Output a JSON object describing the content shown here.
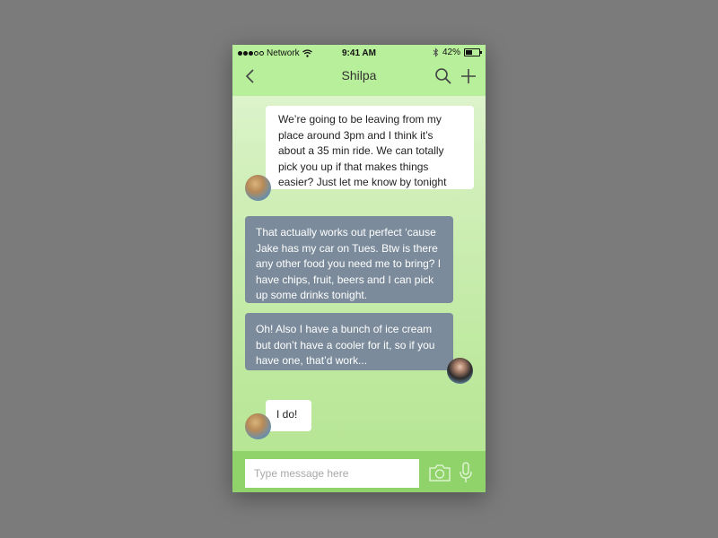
{
  "status_bar": {
    "signal_dots_filled": 3,
    "signal_dots_total": 5,
    "carrier": "Network",
    "time": "9:41 AM",
    "battery": "42%",
    "battery_level": 0.42,
    "icons": [
      "wifi-icon",
      "bluetooth-icon",
      "battery-icon"
    ]
  },
  "header": {
    "title": "Shilpa",
    "icons": [
      "back-chevron-icon",
      "search-icon",
      "plus-icon"
    ]
  },
  "messages": [
    {
      "sender": "contact",
      "text": "We’re going to be leaving from my place around 3pm and I think it’s about a 35 min ride. We can totally pick you up if that makes things easier? Just let me know by tonight"
    },
    {
      "sender": "me",
      "text": "That actually works out perfect ‘cause Jake has my car on Tues. Btw is there any other food you need me to bring? I have chips, fruit, beers and I can pick up some drinks tonight."
    },
    {
      "sender": "me",
      "text": "Oh! Also I have a bunch of ice cream but don’t have a cooler for it, so if you have one, that’d work..."
    },
    {
      "sender": "contact",
      "text": "I do!"
    }
  ],
  "composer": {
    "placeholder": "Type message here",
    "value": "",
    "icons": [
      "camera-icon",
      "microphone-icon"
    ]
  },
  "colors": {
    "header_bg": "#b8ef9a",
    "composer_bg": "#8fd36a",
    "outgoing_bubble": "#7b8b9b",
    "incoming_bubble": "#ffffff"
  }
}
